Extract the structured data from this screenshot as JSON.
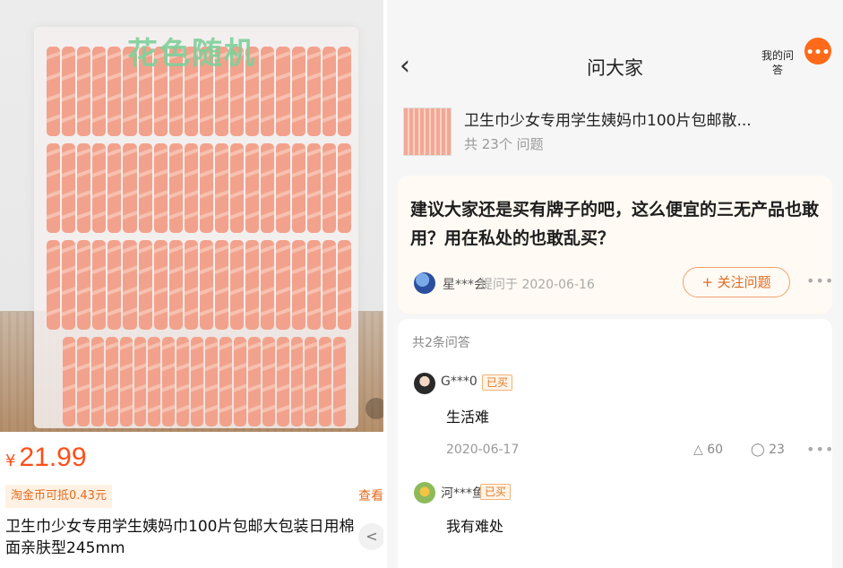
{
  "product_panel": {
    "photo_caption": "花色随机",
    "price_currency": "¥",
    "price": "21.99",
    "coin_tag": "淘金币可抵0.43元",
    "view_more": "查看",
    "title": "卫生巾少女专用学生姨妈巾100片包邮大包装日用棉面亲肤型245mm",
    "share_icon": "share-icon"
  },
  "qa_panel": {
    "nav_title": "问大家",
    "my_qa": "我的问答",
    "more_dots": "•••",
    "product_name": "卫生巾少女专用学生姨妈巾100片包邮散...",
    "question_count": "共 23个 问题",
    "question": {
      "text": "建议大家还是买有牌子的吧，这么便宜的三无产品也敢用？用在私处的也敢乱买？",
      "asker": "星***会",
      "asked_at": "提问于 2020-06-16",
      "follow_label": "+ 关注问题",
      "more": "•••"
    },
    "answers_total": "共2条问答",
    "answers": [
      {
        "user": "G***0",
        "badge": "已买",
        "text": "生活难",
        "date": "2020-06-17",
        "likes": "60",
        "comments": "23",
        "more": "•••"
      },
      {
        "user": "河***鱼",
        "badge": "已买",
        "text": "我有难处"
      }
    ]
  },
  "colors": {
    "accent_orange": "#ff4e1a",
    "follow_border": "#f0a072",
    "card_bg": "#fffaf3"
  }
}
